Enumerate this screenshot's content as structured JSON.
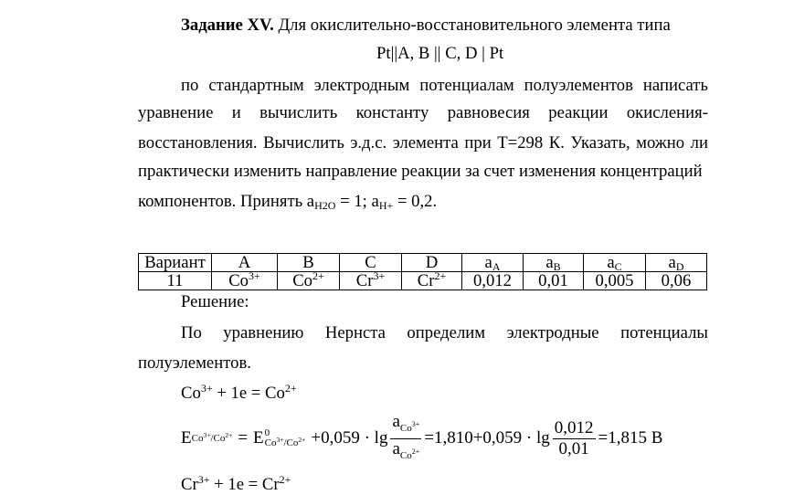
{
  "task": {
    "title_bold": "Задание XV.",
    "title_rest": " Для окислительно-восстановительного элемента типа",
    "cell_scheme": "Pt||A, B || C, D | Pt",
    "paragraph_lines": [
      [
        "по",
        "стандартным",
        "электродным",
        "потенциалам",
        "полуэлементов",
        "написать"
      ],
      [
        "уравнение",
        "и",
        "вычислить",
        "константу",
        "равновесия",
        "реакции",
        "окисления-"
      ],
      [
        "восстановления.",
        "Вычислить",
        "э.д.с.",
        "элемента",
        "при",
        "Т=298",
        "К.",
        "Указать,",
        "можно",
        "ли"
      ],
      [
        "практически изменить направление реакции за счет изменения концентраций"
      ]
    ],
    "last_line_prefix": "компонентов. Принять a",
    "a_h2o_sub": "H2O",
    "a_h2o_value": " = 1; a",
    "a_h_sub": "H+",
    "a_h_value": " = 0,2."
  },
  "table": {
    "headers": [
      {
        "main": "Вариант",
        "sub": ""
      },
      {
        "main": "A",
        "sub": ""
      },
      {
        "main": "B",
        "sub": ""
      },
      {
        "main": "C",
        "sub": ""
      },
      {
        "main": "D",
        "sub": ""
      },
      {
        "main": "a",
        "sub": "A"
      },
      {
        "main": "a",
        "sub": "B"
      },
      {
        "main": "a",
        "sub": "C"
      },
      {
        "main": "a",
        "sub": "D"
      }
    ],
    "row": [
      {
        "main": "11",
        "sup": ""
      },
      {
        "main": "Co",
        "sup": "3+"
      },
      {
        "main": "Co",
        "sup": "2+"
      },
      {
        "main": "Cr",
        "sup": "3+"
      },
      {
        "main": "Cr",
        "sup": "2+"
      },
      {
        "main": "0,012",
        "sup": ""
      },
      {
        "main": "0,01",
        "sup": ""
      },
      {
        "main": "0,005",
        "sup": ""
      },
      {
        "main": "0,06",
        "sup": ""
      }
    ]
  },
  "solution": {
    "heading": "Решение:",
    "intro_words": [
      "По",
      "уравнению",
      "Нернста",
      "определим",
      "электродные",
      "потенциалы"
    ],
    "intro_end": "полуэлементов.",
    "reaction1": {
      "left": "Co",
      "left_sup": "3+",
      "mid": " + 1e = Co",
      "right_sup": "2+"
    },
    "formula": {
      "E": "E",
      "E_sub_1": "Co",
      "E_sup_1": "3+",
      "E_sub_sep": "/Co",
      "E_sup_2": "2+",
      "eq": "=",
      "E0": "E",
      "E0_sup": "0",
      "plus_term": "+0,059 · lg",
      "num_a": "a",
      "num_sub": "Co",
      "num_sup": "3+",
      "den_a": "a",
      "den_sub": "Co",
      "den_sup": "2+",
      "eq2": "=1,810+0,059 · lg",
      "frac_num": "0,012",
      "frac_den": "0,01",
      "result": "=1,815 В"
    },
    "reaction2": {
      "left": "Cr",
      "left_sup": "3+",
      "mid": " + 1e = Cr",
      "right_sup": "2+"
    }
  }
}
